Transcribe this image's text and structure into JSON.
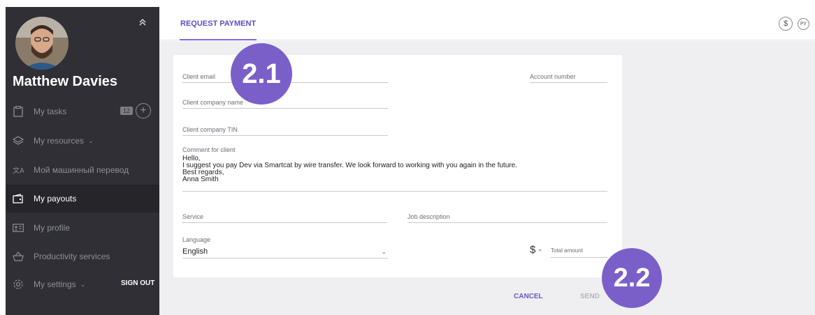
{
  "user": {
    "name": "Matthew Davies"
  },
  "sidebar": {
    "items": [
      {
        "label": "My tasks",
        "icon": "clipboard-icon",
        "badge": "12"
      },
      {
        "label": "My resources",
        "icon": "layers-icon"
      },
      {
        "label": "Мой машинный перевод",
        "icon": "translate-icon"
      },
      {
        "label": "My payouts",
        "icon": "wallet-icon"
      },
      {
        "label": "My profile",
        "icon": "profile-card-icon"
      },
      {
        "label": "Productivity services",
        "icon": "basket-icon"
      },
      {
        "label": "My settings",
        "icon": "gear-icon"
      }
    ],
    "sign_out": "SIGN OUT"
  },
  "header": {
    "tab": "REQUEST PAYMENT",
    "currency_usd": "$",
    "currency_rub": "РУ"
  },
  "form": {
    "client_email": "Client email",
    "account_number": "Account number",
    "client_company_name": "Client company name",
    "client_company_tin": "Client company TIN",
    "comment_label": "Comment for client",
    "comment_lines": [
      "Hello,",
      "I suggest you pay Dev via Smartcat by wire transfer. We look forward to working with you again in the future.",
      "Best regards,",
      "Anna Smith"
    ],
    "service": "Service",
    "job_description": "Job description",
    "language_label": "Language",
    "language_value": "English",
    "currency_symbol": "$",
    "total_amount": "Total amount"
  },
  "actions": {
    "cancel": "CANCEL",
    "send": "SEND"
  },
  "markers": {
    "m1": "2.1",
    "m2": "2.2"
  },
  "colors": {
    "accent": "#7b68ee",
    "sidebar": "#2f2f35",
    "marker": "#7b5fc9"
  }
}
